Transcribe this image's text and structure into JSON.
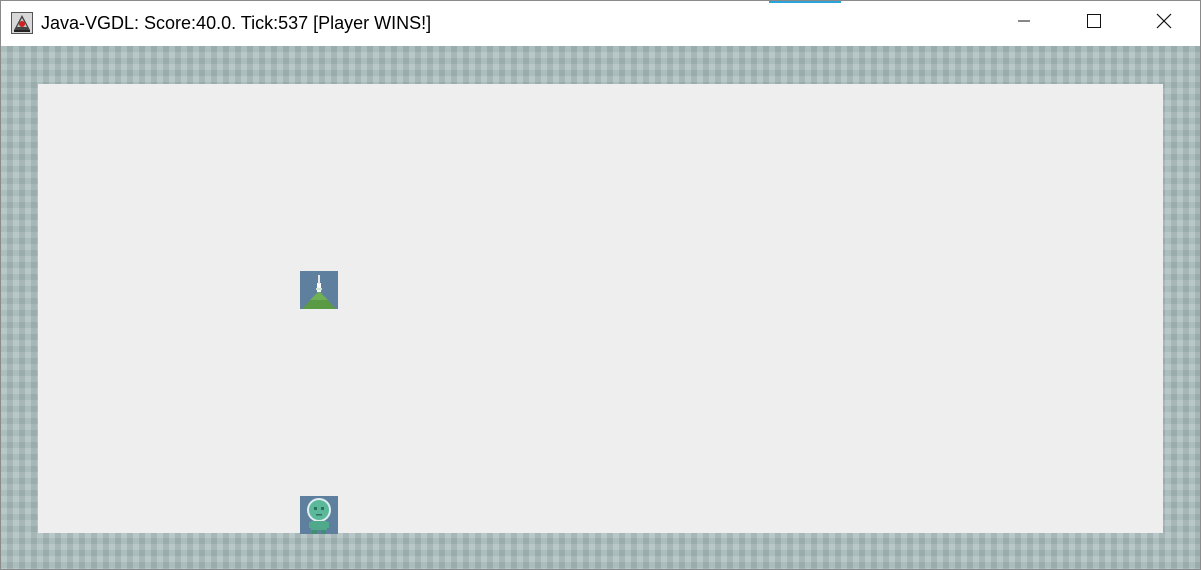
{
  "window": {
    "title": "Java-VGDL: Score:40.0. Tick:537 [Player WINS!]",
    "icon": "java-app-icon",
    "accent_color": "#2aa3d8",
    "controls": {
      "minimize": "minimize-icon",
      "maximize": "maximize-icon",
      "close": "close-icon"
    }
  },
  "game": {
    "score": 40.0,
    "tick": 537,
    "result": "Player WINS!",
    "colors": {
      "wall": "#a9bcbc",
      "floor": "#eeeeee",
      "sprite_bg": "#5f7f9f",
      "goal_green": "#5a9a44",
      "avatar_teal": "#5bb89a"
    },
    "sprites": [
      {
        "type": "goal",
        "icon": "mountain-goal-icon"
      },
      {
        "type": "avatar",
        "icon": "alien-avatar-icon"
      }
    ]
  }
}
